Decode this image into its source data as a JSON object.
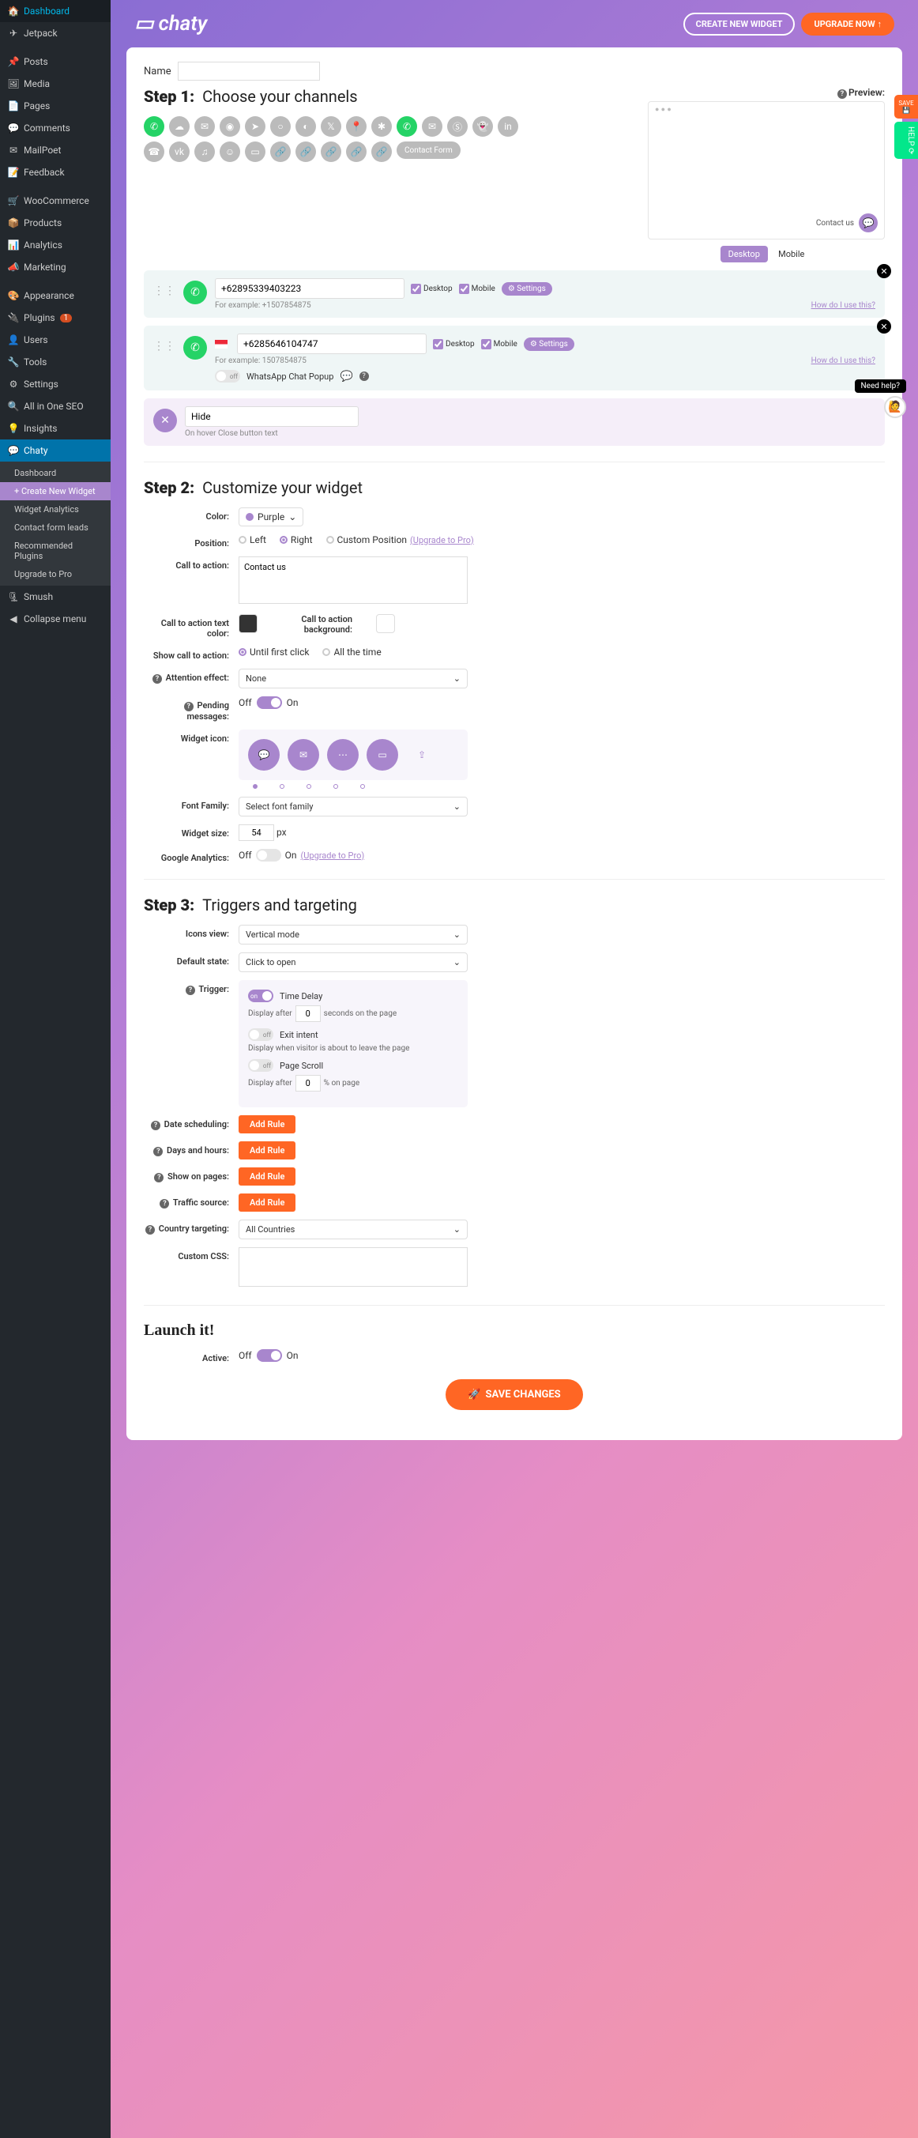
{
  "sidebar": {
    "items": [
      {
        "icon": "🏠",
        "label": "Dashboard"
      },
      {
        "icon": "✈",
        "label": "Jetpack"
      },
      {
        "icon": "📌",
        "label": "Posts"
      },
      {
        "icon": "🖼",
        "label": "Media"
      },
      {
        "icon": "📄",
        "label": "Pages"
      },
      {
        "icon": "💬",
        "label": "Comments"
      },
      {
        "icon": "✉",
        "label": "MailPoet"
      },
      {
        "icon": "📝",
        "label": "Feedback"
      },
      {
        "icon": "🛒",
        "label": "WooCommerce"
      },
      {
        "icon": "📦",
        "label": "Products"
      },
      {
        "icon": "📊",
        "label": "Analytics"
      },
      {
        "icon": "📣",
        "label": "Marketing"
      },
      {
        "icon": "🎨",
        "label": "Appearance"
      },
      {
        "icon": "🔌",
        "label": "Plugins",
        "badge": "1"
      },
      {
        "icon": "👤",
        "label": "Users"
      },
      {
        "icon": "🔧",
        "label": "Tools"
      },
      {
        "icon": "⚙",
        "label": "Settings"
      },
      {
        "icon": "🔍",
        "label": "All in One SEO"
      },
      {
        "icon": "💡",
        "label": "Insights"
      },
      {
        "icon": "💬",
        "label": "Chaty",
        "active": true
      }
    ],
    "sub": [
      {
        "label": "Dashboard"
      },
      {
        "label": "+ Create New Widget",
        "highlight": true
      },
      {
        "label": "Widget Analytics"
      },
      {
        "label": "Contact form leads"
      },
      {
        "label": "Recommended Plugins"
      },
      {
        "label": "Upgrade to Pro"
      }
    ],
    "after": [
      {
        "icon": "🗜",
        "label": "Smush"
      },
      {
        "icon": "◀",
        "label": "Collapse menu"
      }
    ]
  },
  "header": {
    "logo": "chaty",
    "create": "CREATE NEW WIDGET",
    "upgrade": "UPGRADE NOW"
  },
  "name_label": "Name",
  "name_value": "",
  "step1": {
    "title": "Step 1:",
    "subtitle": "Choose your channels",
    "preview_label": "Preview:",
    "preview_contact": "Contact us",
    "tabs": {
      "desktop": "Desktop",
      "mobile": "Mobile"
    },
    "contact_form": "Contact Form",
    "cards": [
      {
        "icon_bg": "#25d366",
        "value": "+62895339403223",
        "example": "For example: +1507854875",
        "desktop": "Desktop",
        "mobile": "Mobile",
        "settings": "Settings",
        "link": "How do I use this?"
      },
      {
        "icon_bg": "#25d366",
        "value": "+6285646104747",
        "example": "For example: 1507854875",
        "desktop": "Desktop",
        "mobile": "Mobile",
        "settings": "Settings",
        "link": "How do I use this?",
        "popup": "WhatsApp Chat Popup",
        "flag": true
      }
    ],
    "hide": {
      "value": "Hide",
      "hint": "On hover Close button text"
    }
  },
  "step2": {
    "title": "Step 2:",
    "subtitle": "Customize your widget",
    "color_label": "Color:",
    "color_value": "Purple",
    "position_label": "Position:",
    "pos_left": "Left",
    "pos_right": "Right",
    "pos_custom": "Custom Position",
    "upgrade": "(Upgrade to Pro)",
    "cta_label": "Call to action:",
    "cta_value": "Contact us",
    "cta_text_color": "Call to action text color:",
    "cta_bg": "Call to action background:",
    "show_cta_label": "Show call to action:",
    "until_click": "Until first click",
    "all_time": "All the time",
    "attention_label": "Attention effect:",
    "attention_value": "None",
    "pending_label": "Pending messages:",
    "off": "Off",
    "on": "On",
    "widget_icon_label": "Widget icon:",
    "font_label": "Font Family:",
    "font_value": "Select font family",
    "size_label": "Widget size:",
    "size_value": "54",
    "size_unit": "px",
    "ga_label": "Google Analytics:"
  },
  "step3": {
    "title": "Step 3:",
    "subtitle": "Triggers and targeting",
    "icons_view_label": "Icons view:",
    "icons_view_value": "Vertical mode",
    "default_state_label": "Default state:",
    "default_state_value": "Click to open",
    "trigger_label": "Trigger:",
    "time_delay": "Time Delay",
    "display_after": "Display after",
    "seconds": "seconds on the page",
    "delay_val": "0",
    "exit_intent": "Exit intent",
    "exit_desc": "Display when visitor is about to leave the page",
    "page_scroll": "Page Scroll",
    "scroll_val": "0",
    "scroll_unit": "% on page",
    "date_label": "Date scheduling:",
    "days_label": "Days and hours:",
    "show_label": "Show on pages:",
    "traffic_label": "Traffic source:",
    "country_label": "Country targeting:",
    "country_value": "All Countries",
    "css_label": "Custom CSS:",
    "add_rule": "Add Rule"
  },
  "launch": {
    "title": "Launch it!",
    "active_label": "Active:",
    "off": "Off",
    "on": "On",
    "save": "SAVE CHANGES"
  },
  "side": {
    "save": "SAVE",
    "help": "HELP",
    "need_help": "Need help?"
  }
}
